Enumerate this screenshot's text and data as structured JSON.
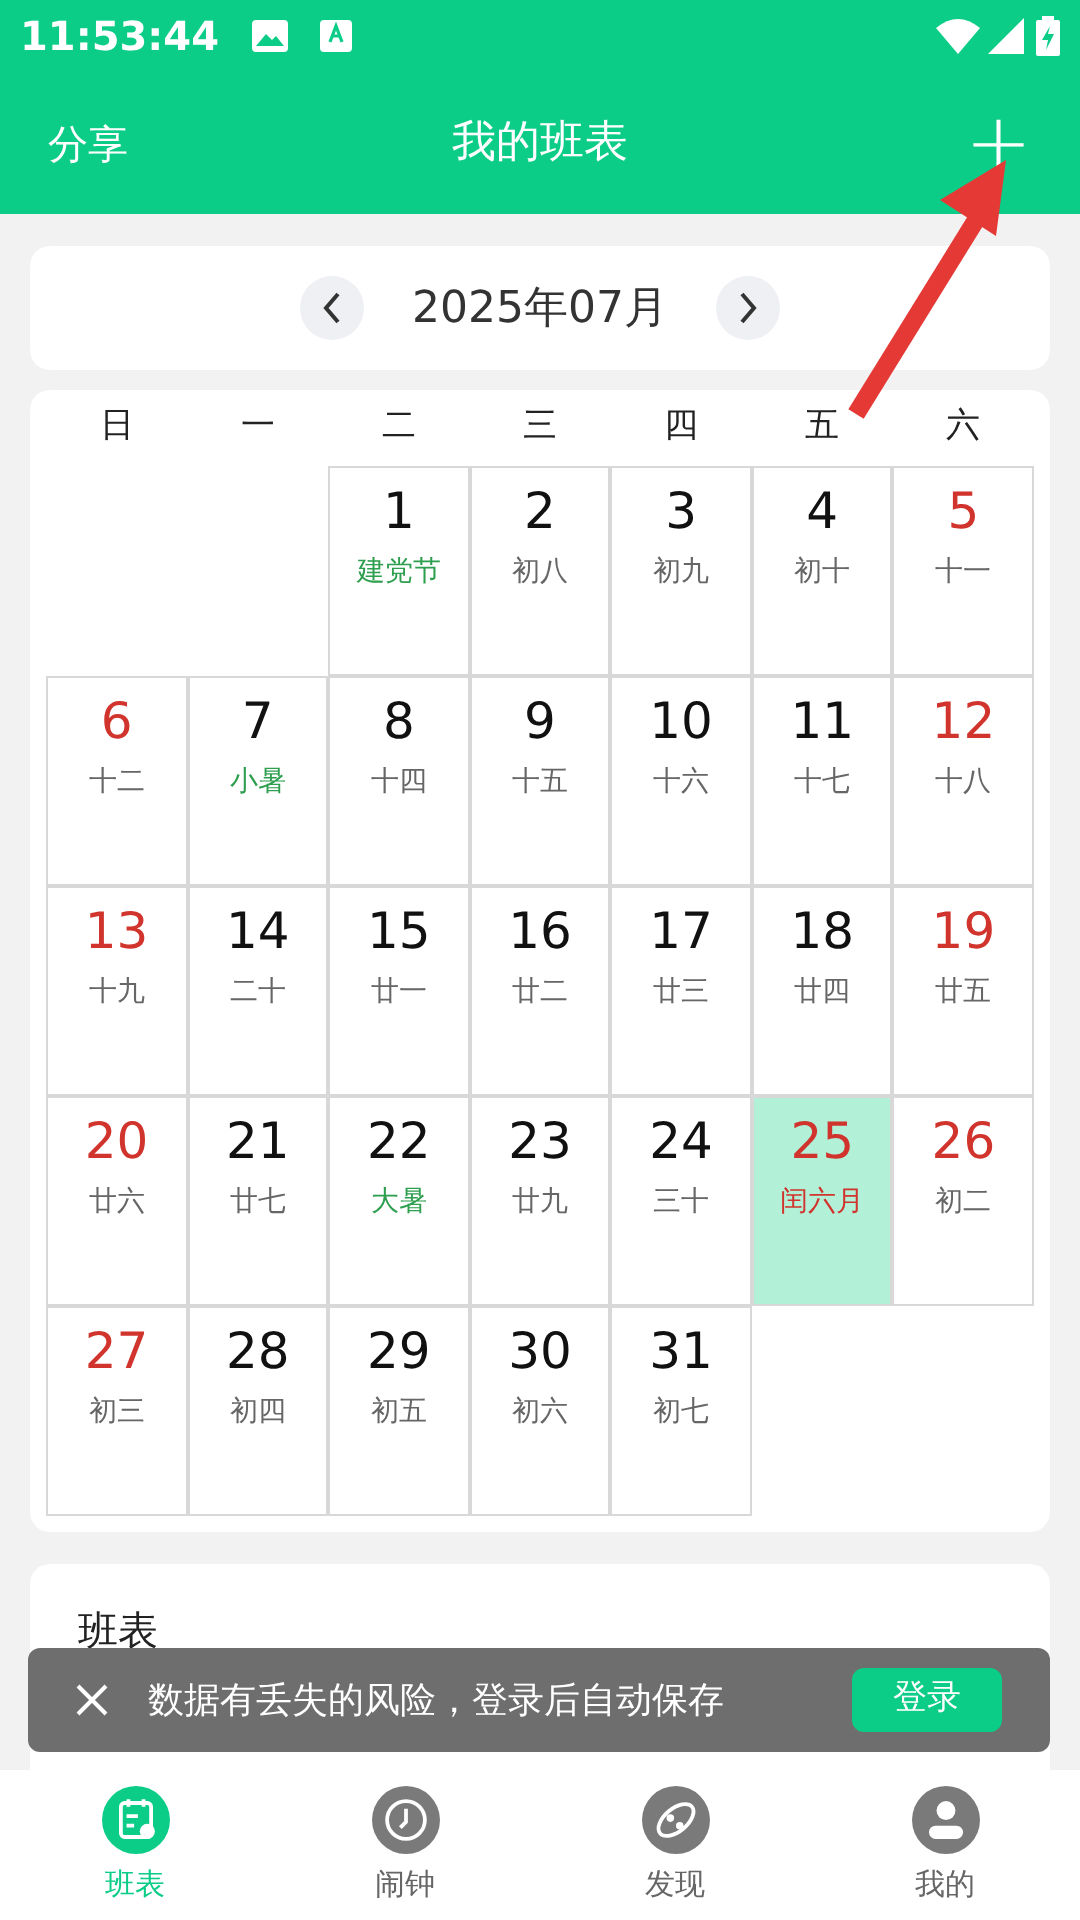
{
  "status_bar": {
    "time": "11:53:44"
  },
  "header": {
    "left": "分享",
    "title": "我的班表",
    "add": "+"
  },
  "month_bar": {
    "label": "2025年07月"
  },
  "calendar": {
    "weekdays": [
      "日",
      "一",
      "二",
      "三",
      "四",
      "五",
      "六"
    ],
    "cells": [
      {
        "kind": "empty"
      },
      {
        "kind": "empty"
      },
      {
        "kind": "day",
        "day": "1",
        "sub": "建党节",
        "weekend": false,
        "festival": true,
        "today": false
      },
      {
        "kind": "day",
        "day": "2",
        "sub": "初八",
        "weekend": false,
        "festival": false,
        "today": false
      },
      {
        "kind": "day",
        "day": "3",
        "sub": "初九",
        "weekend": false,
        "festival": false,
        "today": false
      },
      {
        "kind": "day",
        "day": "4",
        "sub": "初十",
        "weekend": false,
        "festival": false,
        "today": false
      },
      {
        "kind": "day",
        "day": "5",
        "sub": "十一",
        "weekend": true,
        "festival": false,
        "today": false
      },
      {
        "kind": "day",
        "day": "6",
        "sub": "十二",
        "weekend": true,
        "festival": false,
        "today": false
      },
      {
        "kind": "day",
        "day": "7",
        "sub": "小暑",
        "weekend": false,
        "festival": true,
        "today": false
      },
      {
        "kind": "day",
        "day": "8",
        "sub": "十四",
        "weekend": false,
        "festival": false,
        "today": false
      },
      {
        "kind": "day",
        "day": "9",
        "sub": "十五",
        "weekend": false,
        "festival": false,
        "today": false
      },
      {
        "kind": "day",
        "day": "10",
        "sub": "十六",
        "weekend": false,
        "festival": false,
        "today": false
      },
      {
        "kind": "day",
        "day": "11",
        "sub": "十七",
        "weekend": false,
        "festival": false,
        "today": false
      },
      {
        "kind": "day",
        "day": "12",
        "sub": "十八",
        "weekend": true,
        "festival": false,
        "today": false
      },
      {
        "kind": "day",
        "day": "13",
        "sub": "十九",
        "weekend": true,
        "festival": false,
        "today": false
      },
      {
        "kind": "day",
        "day": "14",
        "sub": "二十",
        "weekend": false,
        "festival": false,
        "today": false
      },
      {
        "kind": "day",
        "day": "15",
        "sub": "廿一",
        "weekend": false,
        "festival": false,
        "today": false
      },
      {
        "kind": "day",
        "day": "16",
        "sub": "廿二",
        "weekend": false,
        "festival": false,
        "today": false
      },
      {
        "kind": "day",
        "day": "17",
        "sub": "廿三",
        "weekend": false,
        "festival": false,
        "today": false
      },
      {
        "kind": "day",
        "day": "18",
        "sub": "廿四",
        "weekend": false,
        "festival": false,
        "today": false
      },
      {
        "kind": "day",
        "day": "19",
        "sub": "廿五",
        "weekend": true,
        "festival": false,
        "today": false
      },
      {
        "kind": "day",
        "day": "20",
        "sub": "廿六",
        "weekend": true,
        "festival": false,
        "today": false
      },
      {
        "kind": "day",
        "day": "21",
        "sub": "廿七",
        "weekend": false,
        "festival": false,
        "today": false
      },
      {
        "kind": "day",
        "day": "22",
        "sub": "大暑",
        "weekend": false,
        "festival": true,
        "today": false
      },
      {
        "kind": "day",
        "day": "23",
        "sub": "廿九",
        "weekend": false,
        "festival": false,
        "today": false
      },
      {
        "kind": "day",
        "day": "24",
        "sub": "三十",
        "weekend": false,
        "festival": false,
        "today": false
      },
      {
        "kind": "day",
        "day": "25",
        "sub": "闰六月",
        "weekend": false,
        "festival": false,
        "today": true
      },
      {
        "kind": "day",
        "day": "26",
        "sub": "初二",
        "weekend": true,
        "festival": false,
        "today": false
      },
      {
        "kind": "day",
        "day": "27",
        "sub": "初三",
        "weekend": true,
        "festival": false,
        "today": false
      },
      {
        "kind": "day",
        "day": "28",
        "sub": "初四",
        "weekend": false,
        "festival": false,
        "today": false
      },
      {
        "kind": "day",
        "day": "29",
        "sub": "初五",
        "weekend": false,
        "festival": false,
        "today": false
      },
      {
        "kind": "day",
        "day": "30",
        "sub": "初六",
        "weekend": false,
        "festival": false,
        "today": false
      },
      {
        "kind": "day",
        "day": "31",
        "sub": "初七",
        "weekend": false,
        "festival": false,
        "today": false
      }
    ]
  },
  "schedule": {
    "title": "班表"
  },
  "toast": {
    "message": "数据有丢失的风险，登录后自动保存",
    "button": "登录"
  },
  "tabs": [
    {
      "label": "班表",
      "selected": true
    },
    {
      "label": "闹钟",
      "selected": false
    },
    {
      "label": "发现",
      "selected": false
    },
    {
      "label": "我的",
      "selected": false
    }
  ]
}
